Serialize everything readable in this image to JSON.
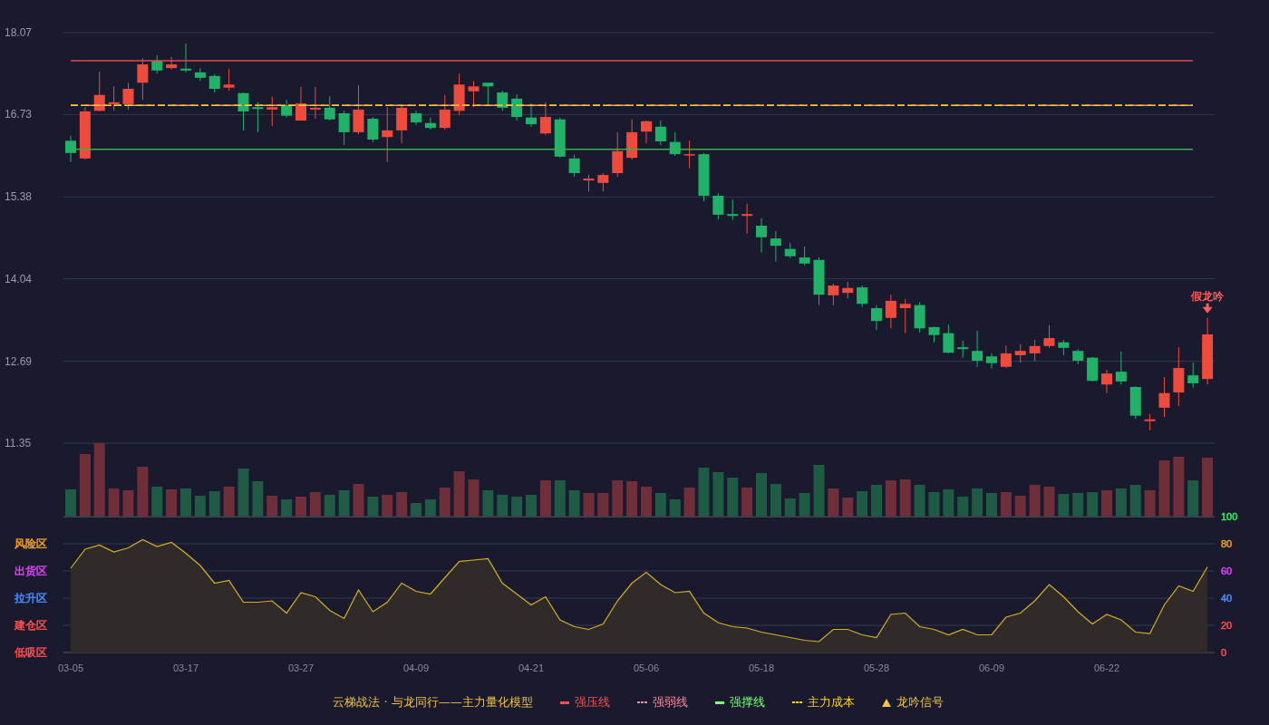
{
  "price_panel": {
    "chart_data": {
      "type": "candlestick",
      "grid": true,
      "yticks": [
        {
          "value": 18.07,
          "label": "18.07"
        },
        {
          "value": 16.73,
          "label": "16.73"
        },
        {
          "value": 15.38,
          "label": "15.38"
        },
        {
          "value": 14.04,
          "label": "14.04"
        },
        {
          "value": 12.69,
          "label": "12.69"
        },
        {
          "value": 11.35,
          "label": "11.35"
        }
      ],
      "ylim": [
        11.35,
        18.07
      ],
      "categories": [
        null,
        null,
        null,
        null,
        null,
        null,
        null,
        null,
        null,
        null,
        null,
        null,
        null,
        null,
        null,
        null,
        null,
        null,
        null,
        null,
        null,
        null,
        null,
        null,
        null,
        null,
        null,
        null,
        null,
        null,
        null,
        null,
        null,
        null,
        null,
        null,
        null,
        null,
        null,
        null,
        null,
        null,
        null,
        null,
        null,
        null,
        null,
        null,
        null,
        null,
        null,
        null,
        null,
        null,
        null,
        null,
        null,
        null,
        null,
        null,
        null,
        null,
        null,
        null,
        null,
        null,
        null,
        null,
        null,
        null,
        null,
        null,
        null,
        null,
        null,
        null,
        null,
        null,
        null,
        null
      ],
      "ohlc": [
        [
          16.3,
          16.38,
          15.95,
          16.1
        ],
        [
          16.01,
          16.85,
          15.99,
          16.78
        ],
        [
          16.79,
          17.43,
          16.78,
          17.05
        ],
        [
          16.9,
          17.19,
          16.79,
          16.93
        ],
        [
          16.9,
          17.25,
          16.81,
          17.15
        ],
        [
          17.25,
          17.65,
          16.97,
          17.55
        ],
        [
          17.61,
          17.7,
          17.4,
          17.45
        ],
        [
          17.49,
          17.67,
          17.46,
          17.55
        ],
        [
          17.48,
          17.89,
          17.42,
          17.45
        ],
        [
          17.42,
          17.49,
          17.28,
          17.33
        ],
        [
          17.36,
          17.39,
          17.09,
          17.15
        ],
        [
          17.17,
          17.48,
          17.12,
          17.22
        ],
        [
          17.08,
          17.09,
          16.47,
          16.78
        ],
        [
          16.85,
          16.93,
          16.44,
          16.82
        ],
        [
          16.81,
          17.02,
          16.54,
          16.85
        ],
        [
          16.88,
          16.97,
          16.68,
          16.71
        ],
        [
          16.63,
          17.18,
          16.63,
          16.91
        ],
        [
          16.81,
          17.18,
          16.66,
          16.84
        ],
        [
          16.84,
          17.03,
          16.63,
          16.65
        ],
        [
          16.75,
          16.79,
          16.23,
          16.44
        ],
        [
          16.44,
          17.21,
          16.41,
          16.81
        ],
        [
          16.66,
          16.69,
          16.28,
          16.32
        ],
        [
          16.36,
          16.85,
          15.95,
          16.47
        ],
        [
          16.47,
          16.88,
          16.26,
          16.84
        ],
        [
          16.75,
          16.79,
          16.56,
          16.6
        ],
        [
          16.59,
          16.68,
          16.48,
          16.51
        ],
        [
          16.51,
          17.05,
          16.48,
          16.81
        ],
        [
          16.79,
          17.4,
          16.72,
          17.22
        ],
        [
          17.11,
          17.28,
          16.85,
          17.19
        ],
        [
          17.25,
          17.25,
          16.87,
          17.19
        ],
        [
          17.09,
          17.12,
          16.79,
          16.84
        ],
        [
          16.99,
          17.06,
          16.63,
          16.69
        ],
        [
          16.68,
          16.91,
          16.53,
          16.57
        ],
        [
          16.42,
          16.93,
          16.39,
          16.69
        ],
        [
          16.65,
          16.68,
          16.02,
          16.04
        ],
        [
          16.01,
          16.07,
          15.71,
          15.77
        ],
        [
          15.65,
          15.74,
          15.47,
          15.68
        ],
        [
          15.61,
          15.77,
          15.47,
          15.74
        ],
        [
          15.77,
          16.44,
          15.71,
          16.13
        ],
        [
          16.02,
          16.65,
          15.99,
          16.44
        ],
        [
          16.45,
          16.63,
          16.26,
          16.62
        ],
        [
          16.53,
          16.63,
          16.23,
          16.29
        ],
        [
          16.28,
          16.44,
          16.05,
          16.08
        ],
        [
          16.07,
          16.3,
          15.85,
          16.08
        ],
        [
          16.08,
          16.1,
          15.31,
          15.4
        ],
        [
          15.4,
          15.44,
          15.01,
          15.09
        ],
        [
          15.1,
          15.34,
          15.0,
          15.07
        ],
        [
          15.07,
          15.27,
          14.78,
          15.1
        ],
        [
          14.91,
          15.03,
          14.47,
          14.72
        ],
        [
          14.7,
          14.82,
          14.32,
          14.58
        ],
        [
          14.53,
          14.63,
          14.38,
          14.41
        ],
        [
          14.39,
          14.57,
          14.26,
          14.29
        ],
        [
          14.35,
          14.39,
          13.61,
          13.78
        ],
        [
          13.77,
          13.96,
          13.61,
          13.93
        ],
        [
          13.81,
          13.99,
          13.72,
          13.89
        ],
        [
          13.9,
          13.93,
          13.58,
          13.63
        ],
        [
          13.56,
          13.61,
          13.2,
          13.35
        ],
        [
          13.4,
          13.78,
          13.23,
          13.68
        ],
        [
          13.56,
          13.71,
          13.15,
          13.63
        ],
        [
          13.61,
          13.66,
          13.16,
          13.23
        ],
        [
          13.25,
          13.26,
          13.0,
          13.12
        ],
        [
          13.15,
          13.29,
          12.82,
          12.83
        ],
        [
          12.92,
          13.03,
          12.75,
          12.89
        ],
        [
          12.86,
          13.19,
          12.6,
          12.7
        ],
        [
          12.77,
          12.82,
          12.57,
          12.66
        ],
        [
          12.6,
          12.95,
          12.58,
          12.82
        ],
        [
          12.79,
          12.97,
          12.67,
          12.86
        ],
        [
          12.82,
          13.04,
          12.69,
          12.94
        ],
        [
          12.94,
          13.28,
          12.91,
          13.07
        ],
        [
          13.0,
          13.04,
          12.79,
          12.91
        ],
        [
          12.86,
          12.89,
          12.64,
          12.7
        ],
        [
          12.75,
          12.76,
          12.36,
          12.37
        ],
        [
          12.31,
          12.55,
          12.17,
          12.49
        ],
        [
          12.52,
          12.85,
          12.31,
          12.36
        ],
        [
          12.27,
          12.28,
          11.75,
          11.8
        ],
        [
          11.71,
          11.83,
          11.56,
          11.74
        ],
        [
          11.93,
          12.43,
          11.78,
          12.17
        ],
        [
          12.18,
          12.92,
          11.96,
          12.58
        ],
        [
          12.46,
          12.67,
          12.26,
          12.33
        ],
        [
          12.4,
          13.4,
          12.31,
          13.13
        ]
      ],
      "ref_lines": [
        {
          "axis": "y",
          "value": 17.61,
          "color": "#e0484a"
        },
        {
          "axis": "y",
          "value": 16.88,
          "color": "#ff8a9a"
        },
        {
          "axis": "y",
          "value": 16.88,
          "color": "#ffd21f"
        },
        {
          "axis": "y",
          "value": 16.16,
          "color": "#3fae49"
        }
      ],
      "annotations": [
        "假龙吟"
      ]
    }
  },
  "oscillator_panel": {
    "zone_labels": [
      {
        "text": "风险区",
        "color": "#f0a020"
      },
      {
        "text": "出货区",
        "color": "#e040fb"
      },
      {
        "text": "拉升区",
        "color": "#4a8cff"
      },
      {
        "text": "建仓区",
        "color": "#ff4d4d"
      },
      {
        "text": "低吸区",
        "color": "#ff4d4d"
      }
    ],
    "axis_labels": [
      {
        "text": "100",
        "color": "#2ee86a"
      },
      {
        "text": "80",
        "color": "#f0a020"
      },
      {
        "text": "60",
        "color": "#e040fb"
      },
      {
        "text": "40",
        "color": "#4a8cff"
      },
      {
        "text": "20",
        "color": "#ff4d4d"
      },
      {
        "text": "0",
        "color": "#ff4d4d"
      }
    ],
    "chart_data": {
      "type": "area",
      "grid": true,
      "ylim": [
        0,
        100
      ],
      "yticks": [
        100,
        80,
        60,
        40,
        20,
        0
      ],
      "categories": [
        "03-05",
        null,
        null,
        null,
        null,
        null,
        null,
        null,
        "03-17",
        null,
        null,
        null,
        null,
        null,
        null,
        null,
        "03-27",
        null,
        null,
        null,
        null,
        null,
        null,
        null,
        "04-09",
        null,
        null,
        null,
        null,
        null,
        null,
        null,
        "04-21",
        null,
        null,
        null,
        null,
        null,
        null,
        null,
        "05-06",
        null,
        null,
        null,
        null,
        null,
        null,
        null,
        "05-18",
        null,
        null,
        null,
        null,
        null,
        null,
        null,
        "05-28",
        null,
        null,
        null,
        null,
        null,
        null,
        null,
        "06-09",
        null,
        null,
        null,
        null,
        null,
        null,
        null,
        "06-22",
        null,
        null,
        null,
        null,
        null,
        null,
        null
      ],
      "series": [
        {
          "color": "#d4b020",
          "values": [
            62,
            76,
            79,
            74,
            77,
            83,
            78,
            81,
            73,
            64,
            51,
            53,
            37,
            37,
            38,
            29,
            44,
            41,
            31,
            25,
            46,
            30,
            37,
            51,
            45,
            43,
            55,
            67,
            68,
            69,
            51,
            43,
            35,
            41,
            24,
            19,
            17,
            21,
            38,
            51,
            59,
            50,
            44,
            45,
            29,
            22,
            19,
            18,
            15,
            13,
            11,
            9,
            8,
            17,
            17,
            13,
            11,
            28,
            29,
            19,
            17,
            13,
            17,
            13,
            13,
            26,
            29,
            38,
            50,
            41,
            30,
            21,
            28,
            24,
            15,
            14,
            35,
            49,
            45,
            63
          ]
        }
      ]
    }
  },
  "legend": [
    {
      "kind": "title",
      "label": "云梯战法 · 与龙同行——主力量化模型",
      "color": "#f0c040"
    },
    {
      "kind": "solid",
      "label": "强压线",
      "color": "#ff4d4d"
    },
    {
      "kind": "dashed",
      "label": "强弱线",
      "color": "#ff8a9a"
    },
    {
      "kind": "solid",
      "label": "强撑线",
      "color": "#7dff7d"
    },
    {
      "kind": "dashed",
      "label": "主力成本",
      "color": "#ffd21f"
    },
    {
      "kind": "triangle",
      "label": "龙吟信号",
      "color": "#f5c542"
    }
  ]
}
